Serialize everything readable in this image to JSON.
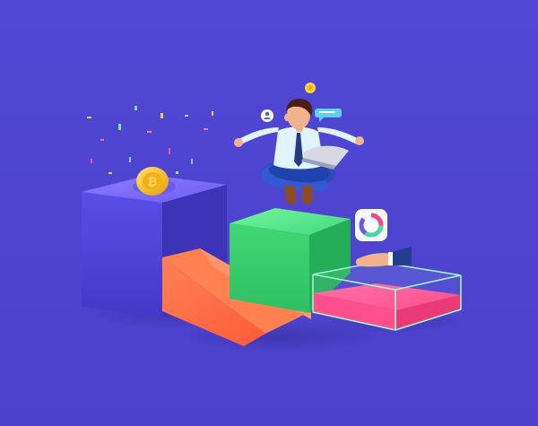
{
  "scene": {
    "description_visible_text": "",
    "objects": [
      "coin-icon",
      "confetti",
      "purple-cube",
      "orange-ramp",
      "green-cube",
      "pink-glass-box",
      "meditating-man",
      "laptop",
      "donut-chart-card",
      "reaching-hand",
      "chat-bubble-icon",
      "user-badge-icon",
      "small-coin-icon"
    ],
    "colors": {
      "background": "#4f45d1",
      "purple_cube_front": "#4f44cc",
      "purple_cube_top": "#6a5ce6",
      "orange": "#ff6a45",
      "green": "#4edc83",
      "pink": "#ff4f8f",
      "coin": "#f3b61b",
      "shirt": "#d9eef8",
      "pants": "#2447b3",
      "hair": "#4b1f14"
    }
  }
}
